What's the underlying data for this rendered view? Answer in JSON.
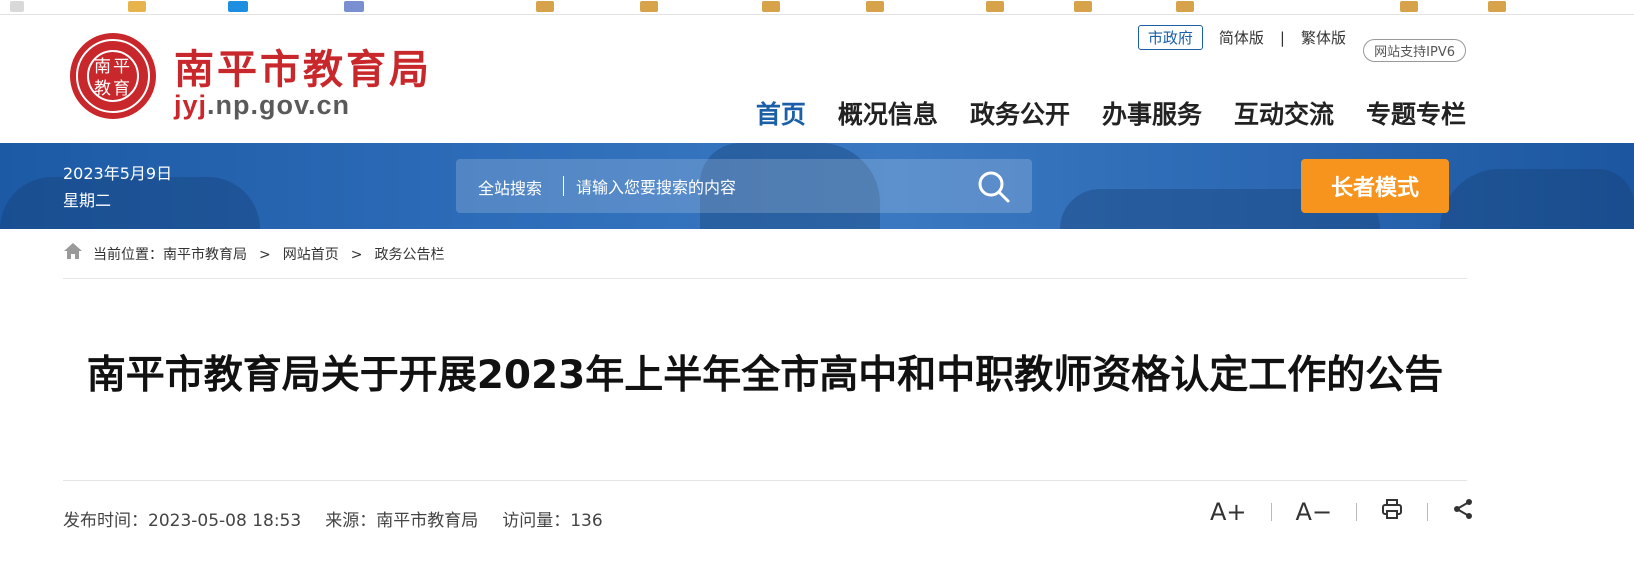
{
  "header": {
    "logo_text": "南平\n教育",
    "site_name": "南平市教育局",
    "domain_highlight": "jyj",
    "domain_rest": ".np.gov.cn",
    "city_gov": "市政府",
    "simplified": "简体版",
    "separator": "|",
    "traditional": "繁体版",
    "ipv6": "网站支持IPV6"
  },
  "nav": {
    "items": [
      {
        "label": "首页",
        "active": true
      },
      {
        "label": "概况信息"
      },
      {
        "label": "政务公开"
      },
      {
        "label": "办事服务"
      },
      {
        "label": "互动交流"
      },
      {
        "label": "专题专栏"
      }
    ]
  },
  "banner": {
    "date": "2023年5月9日",
    "weekday": "星期二",
    "search_label": "全站搜索",
    "search_placeholder": "请输入您要搜索的内容",
    "elder_mode": "长者模式"
  },
  "breadcrumb": {
    "prefix": "当前位置：",
    "items": [
      "南平市教育局",
      "网站首页",
      "政务公告栏"
    ],
    "separator": ">"
  },
  "article": {
    "title": "南平市教育局关于开展2023年上半年全市高中和中职教师资格认定工作的公告",
    "publish_label": "发布时间：",
    "publish_time": "2023-05-08 18:53",
    "source_label": "来源：",
    "source": "南平市教育局",
    "views_label": "访问量：",
    "views": "136"
  },
  "tools": {
    "font_up": "A+",
    "font_down": "A−"
  },
  "colors": {
    "brand_red": "#c8272b",
    "nav_blue": "#1a5fa8",
    "banner_blue": "#2d6cb8",
    "elder_orange": "#f7941d"
  }
}
